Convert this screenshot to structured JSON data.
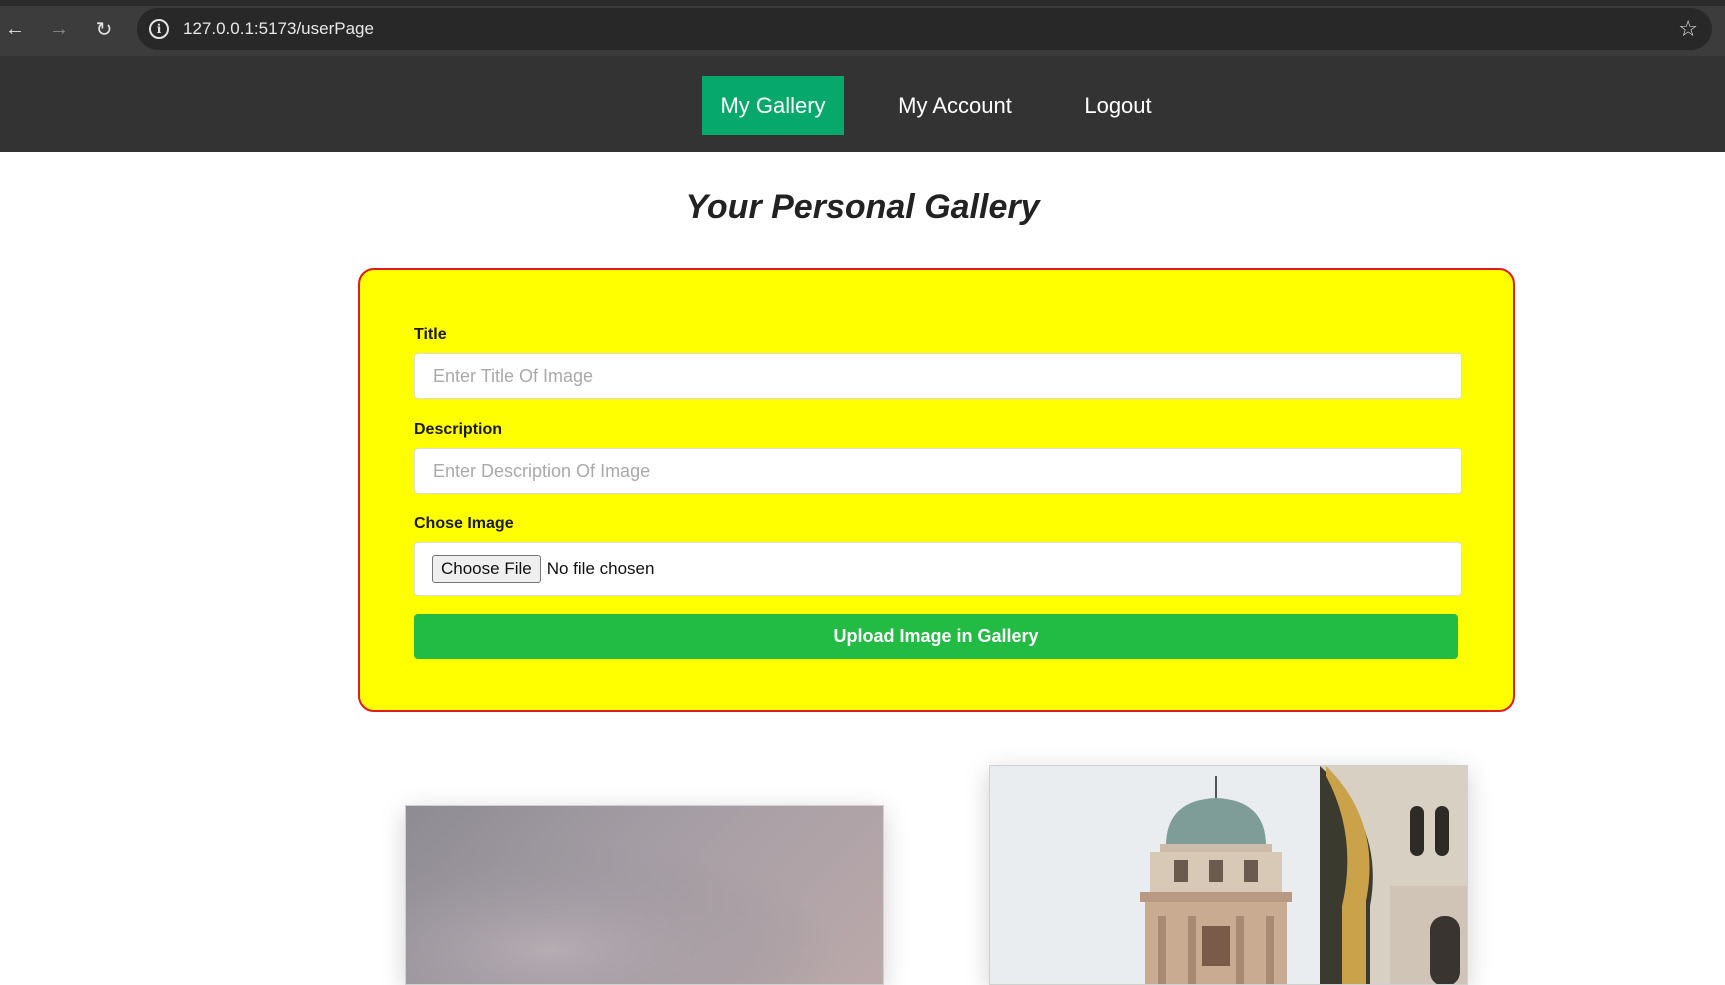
{
  "browser": {
    "url": "127.0.0.1:5173/userPage"
  },
  "nav": {
    "items": [
      {
        "label": "My Gallery",
        "active": true
      },
      {
        "label": "My Account",
        "active": false
      },
      {
        "label": "Logout",
        "active": false
      }
    ]
  },
  "page": {
    "title": "Your Personal Gallery"
  },
  "form": {
    "title_label": "Title",
    "title_placeholder": "Enter Title Of Image",
    "description_label": "Description",
    "description_placeholder": "Enter Description Of Image",
    "image_label": "Chose Image",
    "choose_file_label": "Choose File",
    "file_status": "No file chosen",
    "upload_label": "Upload Image in Gallery"
  },
  "colors": {
    "nav_bg": "#333333",
    "nav_active": "#06a96b",
    "card_bg": "#ffff00",
    "card_border": "#e01b1b",
    "upload_btn": "#22bb44"
  }
}
